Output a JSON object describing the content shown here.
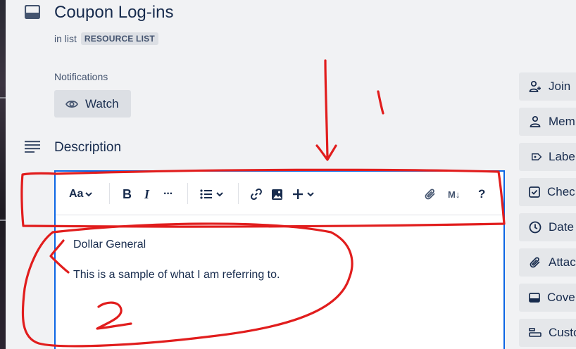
{
  "card": {
    "title": "Coupon Log-ins",
    "in_list_prefix": "in list",
    "list_name": "RESOURCE LIST"
  },
  "notifications": {
    "label": "Notifications",
    "watch_label": "Watch"
  },
  "description": {
    "title": "Description",
    "toolbar": {
      "text_style_label": "Aa",
      "bold_label": "B",
      "italic_label": "I",
      "more_label": "···",
      "markdown_label": "M↓",
      "help_label": "?"
    },
    "lines": [
      "Dollar General",
      "This is a sample of what I am referring to."
    ]
  },
  "sidebar": {
    "items": [
      {
        "label": "Join",
        "icon": "add-person-icon"
      },
      {
        "label": "Mem",
        "icon": "person-icon"
      },
      {
        "label": "Labe",
        "icon": "label-icon"
      },
      {
        "label": "Chec",
        "icon": "checkbox-icon"
      },
      {
        "label": "Date",
        "icon": "clock-icon"
      },
      {
        "label": "Attac",
        "icon": "paperclip-icon"
      },
      {
        "label": "Cove",
        "icon": "cover-icon"
      },
      {
        "label": "Custo",
        "icon": "custom-fields-icon"
      }
    ]
  },
  "annotations": {
    "number_1": "1",
    "number_2": "2",
    "color": "#e11d1d"
  }
}
